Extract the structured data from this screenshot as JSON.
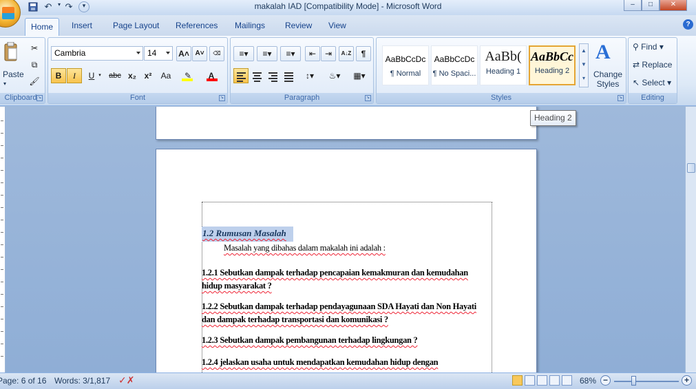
{
  "window": {
    "title": "makalah IAD [Compatibility Mode] - Microsoft Word",
    "minimize": "–",
    "maximize": "□",
    "close": "✕"
  },
  "tabs": [
    {
      "label": "Home",
      "active": true
    },
    {
      "label": "Insert"
    },
    {
      "label": "Page Layout"
    },
    {
      "label": "References"
    },
    {
      "label": "Mailings"
    },
    {
      "label": "Review"
    },
    {
      "label": "View"
    }
  ],
  "help": "?",
  "ribbon": {
    "clipboard": {
      "label": "Clipboard",
      "paste": "Paste"
    },
    "font": {
      "label": "Font",
      "font_name": "Cambria",
      "font_size": "14",
      "grow": "A˄",
      "shrink": "A˅",
      "bold": "B",
      "italic": "I",
      "underline": "U",
      "strike": "abc",
      "subscript": "x₂",
      "superscript": "x²",
      "change_case": "Aa",
      "font_color": "A"
    },
    "paragraph": {
      "label": "Paragraph",
      "sort": "A↓Z",
      "pilcrow": "¶"
    },
    "styles": {
      "label": "Styles",
      "tiles": [
        {
          "sample": "AaBbCcDc",
          "name": "¶ Normal"
        },
        {
          "sample": "AaBbCcDc",
          "name": "¶ No Spaci..."
        },
        {
          "sample": "AaBb(",
          "name": "Heading 1"
        },
        {
          "sample": "AaBbCc",
          "name": "Heading 2",
          "selected": true
        }
      ],
      "change_styles": "Change Styles"
    },
    "editing": {
      "label": "Editing",
      "find": "Find",
      "replace": "Replace",
      "select": "Select"
    }
  },
  "tooltip": "Heading 2",
  "document": {
    "heading": "1.2 Rumusan Masalah",
    "intro": "Masalah yang dibahas dalam makalah ini adalah :",
    "items": [
      {
        "line1": "1.2.1  Sebutkan dampak terhadap pencapaian kemakmuran dan kemudahan",
        "line2": "hidup masyarakat ?"
      },
      {
        "line1": "1.2.2  Sebutkan dampak terhadap pendayagunaan SDA Hayati dan Non Hayati",
        "line2": "dan dampak terhadap transportasi dan komunikasi ?"
      },
      {
        "line1": "1.2.3  Sebutkan dampak pembangunan terhadap lingkungan ?",
        "line2": ""
      },
      {
        "line1": "1.2.4  jelaskan usaha untuk mendapatkan kemudahan hidup dengan",
        "line2": ""
      }
    ]
  },
  "status": {
    "page": "Page: 6 of 16",
    "words": "Words: 3/1,817",
    "zoom": "68%"
  }
}
